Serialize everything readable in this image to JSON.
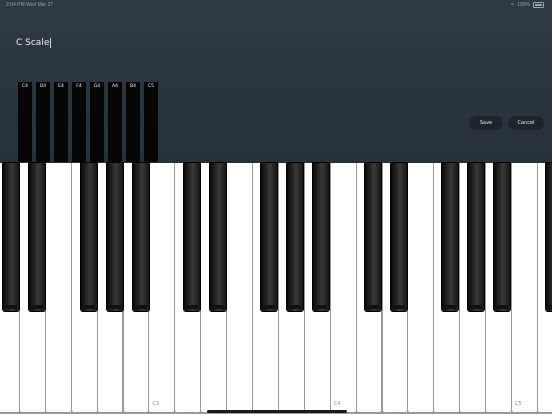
{
  "status": {
    "time": "2:04 PM",
    "date": "Wed Mar 27",
    "battery": "100%"
  },
  "scale": {
    "title": "C Scale"
  },
  "mini_keyboard": {
    "keys": [
      "C4",
      "D4",
      "E4",
      "F4",
      "G4",
      "A4",
      "B4",
      "C5"
    ]
  },
  "buttons": {
    "save": "Save",
    "cancel": "Cancel"
  },
  "keyboard": {
    "labels": {
      "C3": "C3",
      "C4": "C4",
      "C5": "C5"
    }
  },
  "colors": {
    "header_bg": "#2b353d",
    "button_bg": "#1d242a",
    "white_key": "#ffffff",
    "black_key": "#0a0a0a"
  }
}
